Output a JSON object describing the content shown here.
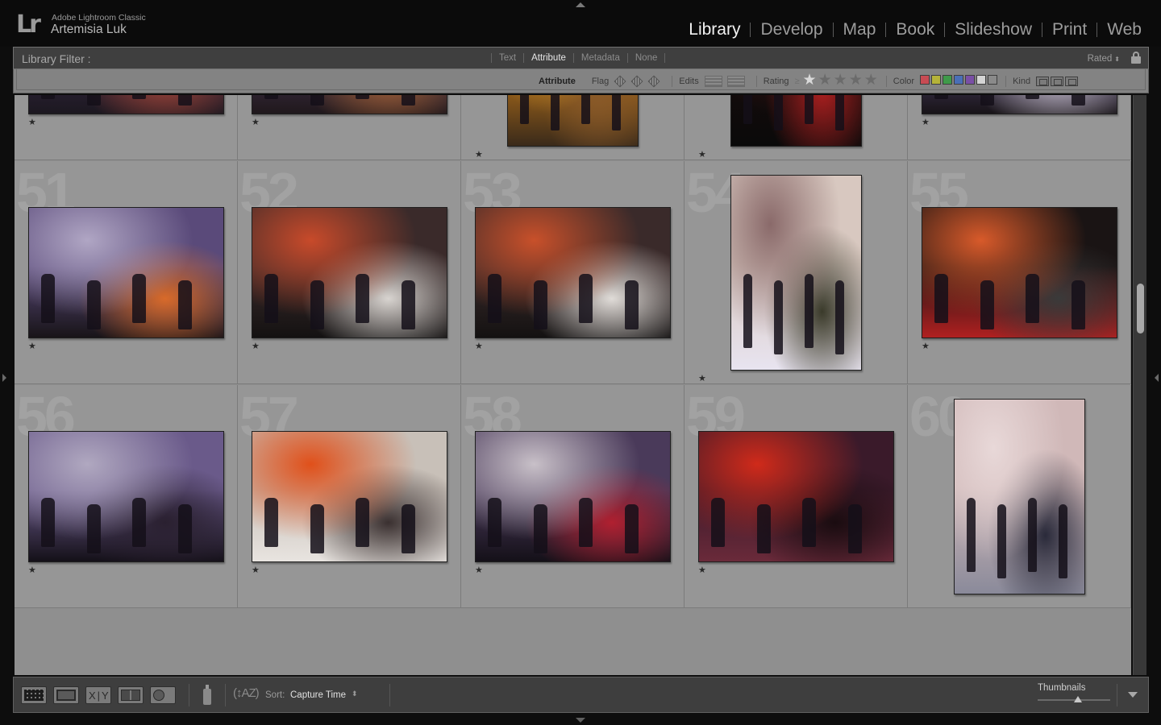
{
  "app": {
    "logo": "Lr",
    "product": "Adobe Lightroom Classic",
    "user": "Artemisia Luk"
  },
  "modules": [
    {
      "label": "Library",
      "active": true
    },
    {
      "label": "Develop",
      "active": false
    },
    {
      "label": "Map",
      "active": false
    },
    {
      "label": "Book",
      "active": false
    },
    {
      "label": "Slideshow",
      "active": false
    },
    {
      "label": "Print",
      "active": false
    },
    {
      "label": "Web",
      "active": false
    }
  ],
  "filter": {
    "title": "Library Filter :",
    "tabs": [
      {
        "label": "Text",
        "active": false
      },
      {
        "label": "Attribute",
        "active": true
      },
      {
        "label": "Metadata",
        "active": false
      },
      {
        "label": "None",
        "active": false
      }
    ],
    "preset": "Rated",
    "attribute": {
      "label": "Attribute",
      "flag_label": "Flag",
      "edits_label": "Edits",
      "rating_label": "Rating",
      "rating_operator": "≥",
      "rating_value": 1,
      "rating_max": 5,
      "color_label": "Color",
      "colors": [
        "#c84b53",
        "#b5b339",
        "#3f9a4a",
        "#4a6fb7",
        "#7a4fa6",
        "#d4d4d4",
        "#8a8a8a"
      ],
      "kind_label": "Kind"
    }
  },
  "grid": {
    "rows": [
      {
        "cells": [
          {
            "index": "",
            "rating": "★",
            "orientation": "landscape",
            "colors": [
              "#3a2a4a",
              "#7a6a9a",
              "#b24a3a",
              "#1c1820"
            ]
          },
          {
            "index": "",
            "rating": "★",
            "orientation": "landscape",
            "colors": [
              "#4a3a5a",
              "#9a8aa0",
              "#b46a3a",
              "#20181c"
            ]
          },
          {
            "index": "",
            "rating": "★",
            "orientation": "portrait",
            "colors": [
              "#e08a1a",
              "#f2b43a",
              "#8a5a2a",
              "#3a2a1a"
            ]
          },
          {
            "index": "",
            "rating": "★",
            "orientation": "portrait",
            "colors": [
              "#1a0c0c",
              "#4a1a1a",
              "#b02020",
              "#0a0a0a"
            ]
          },
          {
            "index": "",
            "rating": "★",
            "orientation": "landscape",
            "colors": [
              "#5a4a7a",
              "#a8a0b8",
              "#d0c8d8",
              "#181418"
            ]
          }
        ]
      },
      {
        "cells": [
          {
            "index": "51",
            "rating": "★",
            "orientation": "landscape",
            "colors": [
              "#5a4a7a",
              "#b0a6c4",
              "#d86a2a",
              "#181418"
            ]
          },
          {
            "index": "52",
            "rating": "★",
            "orientation": "landscape",
            "colors": [
              "#3a2a2a",
              "#c84a2a",
              "#d8d4d0",
              "#141212"
            ]
          },
          {
            "index": "53",
            "rating": "★",
            "orientation": "landscape",
            "colors": [
              "#3a2a2a",
              "#c8502a",
              "#e0dcd8",
              "#141212"
            ]
          },
          {
            "index": "54",
            "rating": "★",
            "orientation": "portrait",
            "colors": [
              "#d8c8c0",
              "#8a6a6a",
              "#3a3a2a",
              "#e8e4f0"
            ]
          },
          {
            "index": "55",
            "rating": "★",
            "orientation": "landscape",
            "colors": [
              "#1a1414",
              "#d85a2a",
              "#3a3a3a",
              "#b02020"
            ]
          }
        ]
      },
      {
        "cells": [
          {
            "index": "56",
            "rating": "★",
            "orientation": "landscape",
            "colors": [
              "#6a5a8a",
              "#b0a8c0",
              "#2a2030",
              "#141018"
            ]
          },
          {
            "index": "57",
            "rating": "★",
            "orientation": "landscape",
            "colors": [
              "#c8c0b8",
              "#e0501a",
              "#3a3030",
              "#e8e4e0"
            ]
          },
          {
            "index": "58",
            "rating": "★",
            "orientation": "landscape",
            "colors": [
              "#4a3a5a",
              "#c8c0c8",
              "#b02030",
              "#141018"
            ]
          },
          {
            "index": "59",
            "rating": "★",
            "orientation": "landscape",
            "colors": [
              "#3a1a2a",
              "#d02a1a",
              "#1a0c10",
              "#6a2a3a"
            ]
          },
          {
            "index": "60",
            "rating": "",
            "orientation": "portrait",
            "colors": [
              "#d0b8b8",
              "#e8d8d8",
              "#2a2a3a",
              "#8a8a9a"
            ]
          }
        ]
      }
    ]
  },
  "toolbar": {
    "sort_label": "Sort:",
    "sort_value": "Capture Time",
    "thumbnails_label": "Thumbnails",
    "thumbnail_size": 0.55
  }
}
